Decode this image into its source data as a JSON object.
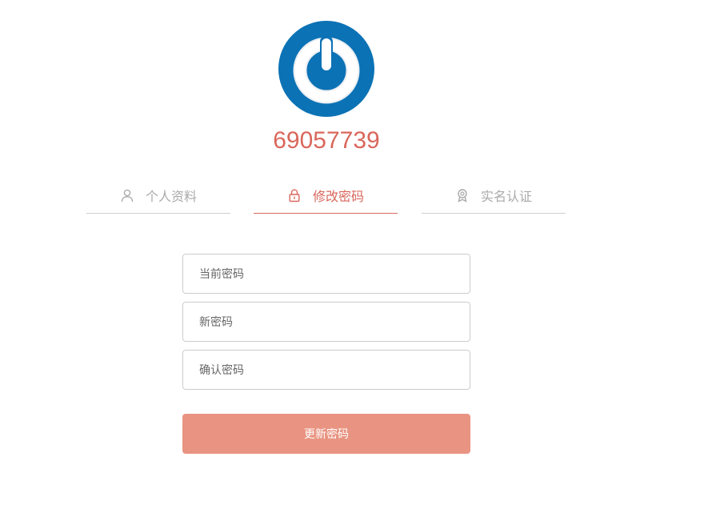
{
  "profile": {
    "user_id": "69057739"
  },
  "tabs": [
    {
      "label": "个人资料",
      "icon": "user-icon",
      "active": false
    },
    {
      "label": "修改密码",
      "icon": "lock-icon",
      "active": true
    },
    {
      "label": "实名认证",
      "icon": "badge-icon",
      "active": false
    }
  ],
  "form": {
    "current_password_placeholder": "当前密码",
    "new_password_placeholder": "新密码",
    "confirm_password_placeholder": "确认密码",
    "submit_label": "更新密码"
  },
  "colors": {
    "accent": "#d9675c",
    "button": "#e99482",
    "logo_blue": "#0b72b5",
    "inactive": "#aaaaaa"
  }
}
